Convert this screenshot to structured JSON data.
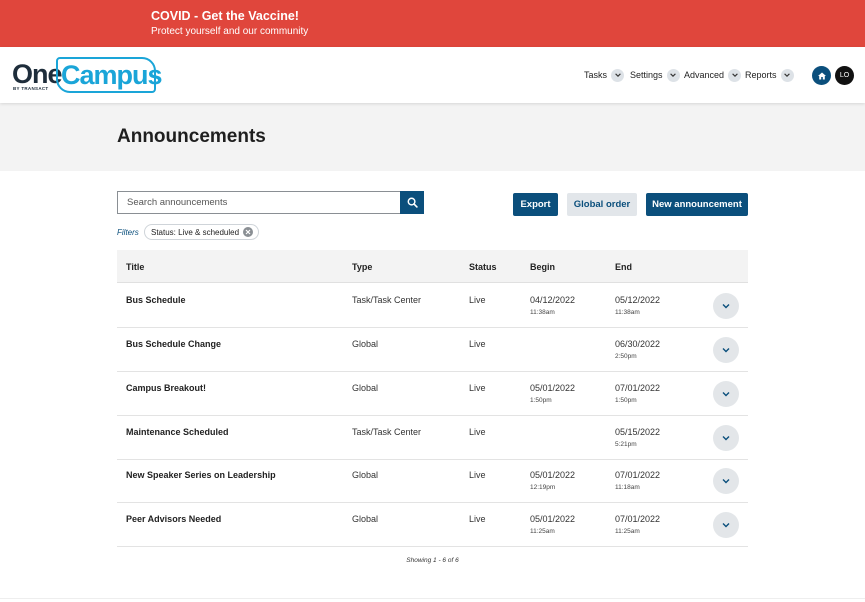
{
  "alert": {
    "title": "COVID - Get the Vaccine!",
    "subtitle": "Protect yourself and our community"
  },
  "logo": {
    "part1": "One",
    "part2": "Campus",
    "byline": "BY TRANSACT"
  },
  "nav": {
    "items": [
      {
        "label": "Tasks",
        "icon": "chevron-down-icon"
      },
      {
        "label": "Settings",
        "icon": "chevron-down-icon"
      },
      {
        "label": "Advanced",
        "icon": "chevron-down-icon"
      },
      {
        "label": "Reports",
        "icon": "chevron-down-icon"
      }
    ],
    "home_icon": "home-icon",
    "avatar_initials": "LO"
  },
  "page": {
    "title": "Announcements"
  },
  "toolbar": {
    "search_placeholder": "Search announcements",
    "search_icon": "search-icon",
    "export_label": "Export",
    "global_order_label": "Global order",
    "new_label": "New announcement"
  },
  "filters": {
    "label": "Filters",
    "chip_label": "Status: Live & scheduled"
  },
  "table": {
    "columns": [
      "Title",
      "Type",
      "Status",
      "Begin",
      "End"
    ],
    "rows": [
      {
        "title": "Bus Schedule",
        "type": "Task/Task Center",
        "status": "Live",
        "begin_date": "04/12/2022",
        "begin_time": "11:38am",
        "end_date": "05/12/2022",
        "end_time": "11:38am"
      },
      {
        "title": "Bus Schedule Change",
        "type": "Global",
        "status": "Live",
        "begin_date": "",
        "begin_time": "",
        "end_date": "06/30/2022",
        "end_time": "2:50pm"
      },
      {
        "title": "Campus Breakout!",
        "type": "Global",
        "status": "Live",
        "begin_date": "05/01/2022",
        "begin_time": "1:50pm",
        "end_date": "07/01/2022",
        "end_time": "1:50pm"
      },
      {
        "title": "Maintenance Scheduled",
        "type": "Task/Task Center",
        "status": "Live",
        "begin_date": "",
        "begin_time": "",
        "end_date": "05/15/2022",
        "end_time": "5:21pm"
      },
      {
        "title": "New Speaker Series on Leadership",
        "type": "Global",
        "status": "Live",
        "begin_date": "05/01/2022",
        "begin_time": "12:19pm",
        "end_date": "07/01/2022",
        "end_time": "11:18am"
      },
      {
        "title": "Peer Advisors Needed",
        "type": "Global",
        "status": "Live",
        "begin_date": "05/01/2022",
        "begin_time": "11:25am",
        "end_date": "07/01/2022",
        "end_time": "11:25am"
      }
    ]
  },
  "footer": {
    "showing": "Showing 1 - 6 of 6"
  },
  "colors": {
    "alert_bg": "#e0463c",
    "primary": "#0b4f7c",
    "logo_accent": "#1aa5d8"
  }
}
